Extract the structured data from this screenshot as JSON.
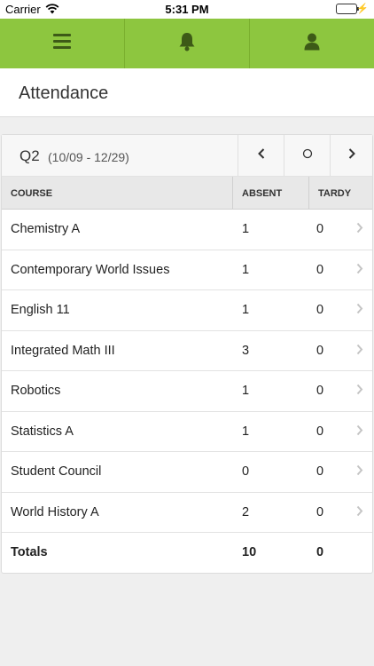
{
  "status_bar": {
    "carrier": "Carrier",
    "time": "5:31 PM"
  },
  "nav": {
    "menu_icon": "hamburger-menu-icon",
    "bell_icon": "bell-icon",
    "user_icon": "user-icon",
    "accent": "#8dc63f"
  },
  "page": {
    "title": "Attendance"
  },
  "term": {
    "label": "Q2",
    "range": "(10/09 - 12/29)"
  },
  "table": {
    "headers": {
      "course": "COURSE",
      "absent": "ABSENT",
      "tardy": "TARDY"
    },
    "rows": [
      {
        "course": "Chemistry A",
        "absent": "1",
        "tardy": "0"
      },
      {
        "course": "Contemporary World Issues",
        "absent": "1",
        "tardy": "0"
      },
      {
        "course": "English 11",
        "absent": "1",
        "tardy": "0"
      },
      {
        "course": "Integrated Math III",
        "absent": "3",
        "tardy": "0"
      },
      {
        "course": "Robotics",
        "absent": "1",
        "tardy": "0"
      },
      {
        "course": "Statistics A",
        "absent": "1",
        "tardy": "0"
      },
      {
        "course": "Student Council",
        "absent": "0",
        "tardy": "0"
      },
      {
        "course": "World History A",
        "absent": "2",
        "tardy": "0"
      }
    ],
    "totals": {
      "label": "Totals",
      "absent": "10",
      "tardy": "0"
    }
  }
}
